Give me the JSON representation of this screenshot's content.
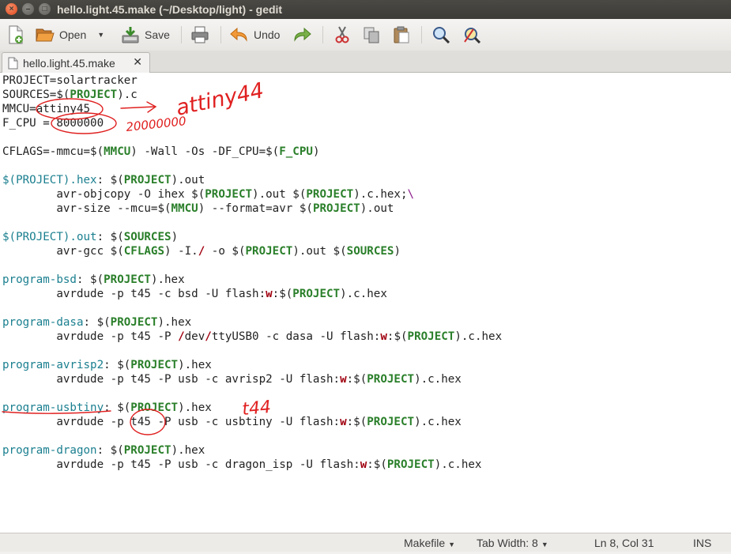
{
  "window": {
    "title": "hello.light.45.make (~/Desktop/light) - gedit"
  },
  "toolbar": {
    "open_label": "Open",
    "save_label": "Save",
    "undo_label": "Undo"
  },
  "tab": {
    "label": "hello.light.45.make",
    "close_glyph": "✕"
  },
  "statusbar": {
    "language": "Makefile",
    "tab_width": "Tab Width: 8",
    "position": "Ln 8, Col 31",
    "mode": "INS"
  },
  "annotations": {
    "attiny_note": "attiny44",
    "fcpu_note": "20000000",
    "t_note": "t44"
  },
  "colors": {
    "variable": "#2a7f2a",
    "target": "#1a7f8f",
    "keyword": "#a0000f",
    "annotation": "#e02020"
  },
  "code": [
    "PROJECT=solartracker",
    "SOURCES=$(PROJECT).c",
    "MMCU=attiny45",
    "F_CPU = 8000000",
    "",
    "CFLAGS=-mmcu=$(MMCU) -Wall -Os -DF_CPU=$(F_CPU)",
    "",
    "$(PROJECT).hex: $(PROJECT).out",
    "        avr-objcopy -O ihex $(PROJECT).out $(PROJECT).c.hex;\\",
    "        avr-size --mcu=$(MMCU) --format=avr $(PROJECT).out",
    "",
    "$(PROJECT).out: $(SOURCES)",
    "        avr-gcc $(CFLAGS) -I./ -o $(PROJECT).out $(SOURCES)",
    "",
    "program-bsd: $(PROJECT).hex",
    "        avrdude -p t45 -c bsd -U flash:w:$(PROJECT).c.hex",
    "",
    "program-dasa: $(PROJECT).hex",
    "        avrdude -p t45 -P /dev/ttyUSB0 -c dasa -U flash:w:$(PROJECT).c.hex",
    "",
    "program-avrisp2: $(PROJECT).hex",
    "        avrdude -p t45 -P usb -c avrisp2 -U flash:w:$(PROJECT).c.hex",
    "",
    "program-usbtiny: $(PROJECT).hex",
    "        avrdude -p t45 -P usb -c usbtiny -U flash:w:$(PROJECT).c.hex",
    "",
    "program-dragon: $(PROJECT).hex",
    "        avrdude -p t45 -P usb -c dragon_isp -U flash:w:$(PROJECT).c.hex"
  ]
}
